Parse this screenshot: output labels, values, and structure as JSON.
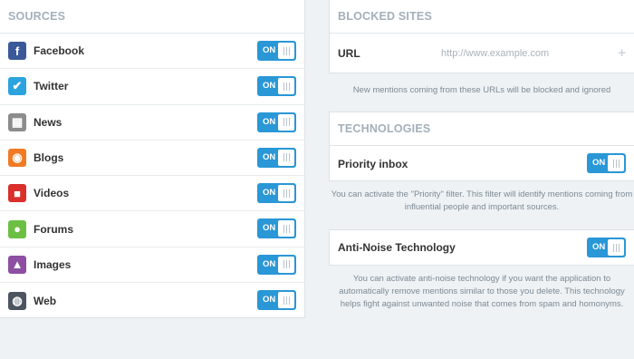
{
  "sources": {
    "header": "SOURCES",
    "items": [
      {
        "label": "Facebook",
        "icon": "facebook-icon",
        "icon_glyph": "f",
        "color": "#3b5998",
        "toggle": "ON"
      },
      {
        "label": "Twitter",
        "icon": "twitter-icon",
        "icon_glyph": "✔",
        "color": "#2aa3de",
        "toggle": "ON"
      },
      {
        "label": "News",
        "icon": "news-icon",
        "icon_glyph": "▦",
        "color": "#8c8c8c",
        "toggle": "ON"
      },
      {
        "label": "Blogs",
        "icon": "rss-icon",
        "icon_glyph": "◉",
        "color": "#f07b24",
        "toggle": "ON"
      },
      {
        "label": "Videos",
        "icon": "video-icon",
        "icon_glyph": "■",
        "color": "#d9302c",
        "toggle": "ON"
      },
      {
        "label": "Forums",
        "icon": "forum-icon",
        "icon_glyph": "●",
        "color": "#6cbf43",
        "toggle": "ON"
      },
      {
        "label": "Images",
        "icon": "image-icon",
        "icon_glyph": "▲",
        "color": "#8e4fa3",
        "toggle": "ON"
      },
      {
        "label": "Web",
        "icon": "globe-icon",
        "icon_glyph": "◍",
        "color": "#4c5460",
        "toggle": "ON"
      }
    ]
  },
  "blocked_sites": {
    "header": "BLOCKED SITES",
    "url_label": "URL",
    "url_placeholder": "http://www.example.com",
    "add_icon": "plus-icon",
    "note": "New mentions coming from these URLs will be blocked and ignored"
  },
  "technologies": {
    "header": "TECHNOLOGIES",
    "priority_label": "Priority inbox",
    "priority_toggle": "ON",
    "priority_note": "You can activate the \"Priority\" filter. This filter will identify mentions coming from influential people and important sources.",
    "antinoise_label": "Anti-Noise Technology",
    "antinoise_toggle": "ON",
    "antinoise_note": "You can activate anti-noise technology if you want the application to automatically remove mentions similar to those you delete. This technology helps fight against unwanted noise that comes from spam and homonyms."
  },
  "colors": {
    "toggle_on": "#2a97d6",
    "header_text": "#a3b0bb",
    "background": "#eef2f5"
  }
}
